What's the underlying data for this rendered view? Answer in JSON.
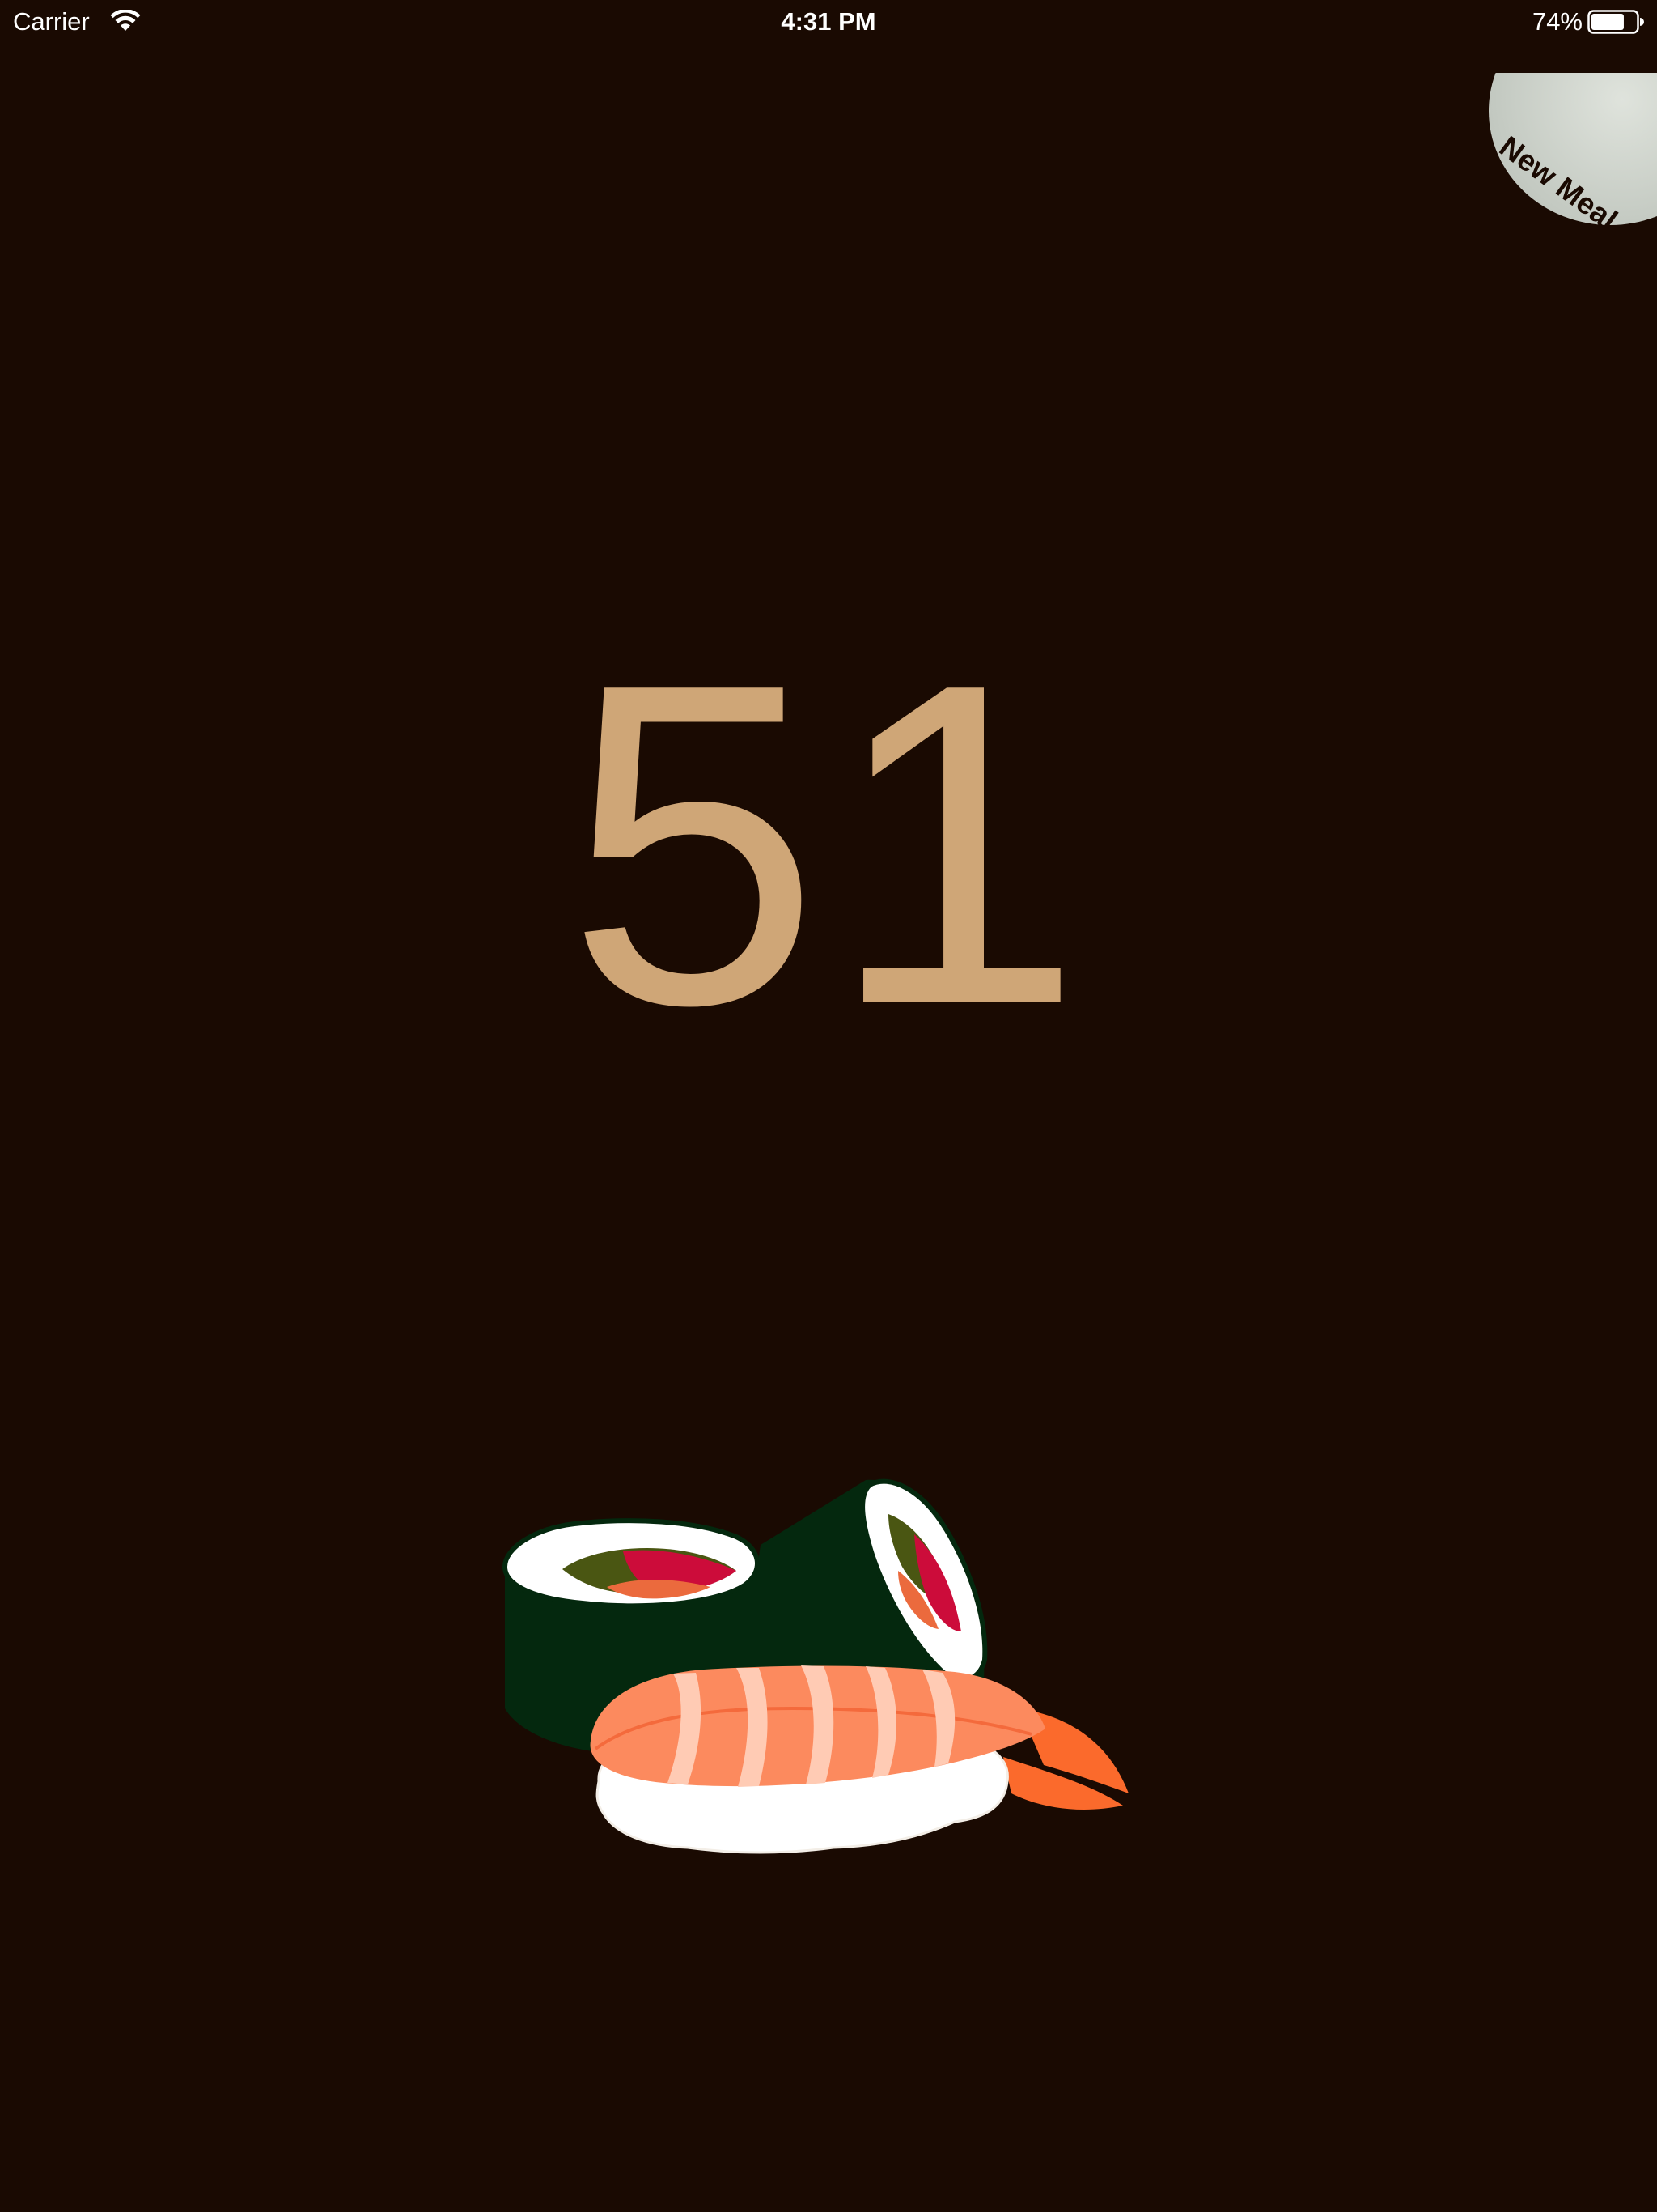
{
  "status_bar": {
    "carrier": "Carrier",
    "time": "4:31 PM",
    "battery_percent": "74%",
    "battery_level": 0.74,
    "icons": [
      "wifi-icon",
      "battery-icon"
    ]
  },
  "new_meal": {
    "label": "New Meal"
  },
  "counter": {
    "value": "51"
  },
  "illustration": {
    "subject": "sushi-illustration"
  },
  "colors": {
    "background": "#1a0a02",
    "counter_text": "#cfa677",
    "new_meal_button": "#cfd4cc",
    "nori": "#04280e",
    "rice": "#ffffff",
    "salmon": "#fc8a5e",
    "tuna": "#cc0c3a",
    "cucumber": "#4a5612",
    "shrimp_tail": "#fb6a2c"
  }
}
